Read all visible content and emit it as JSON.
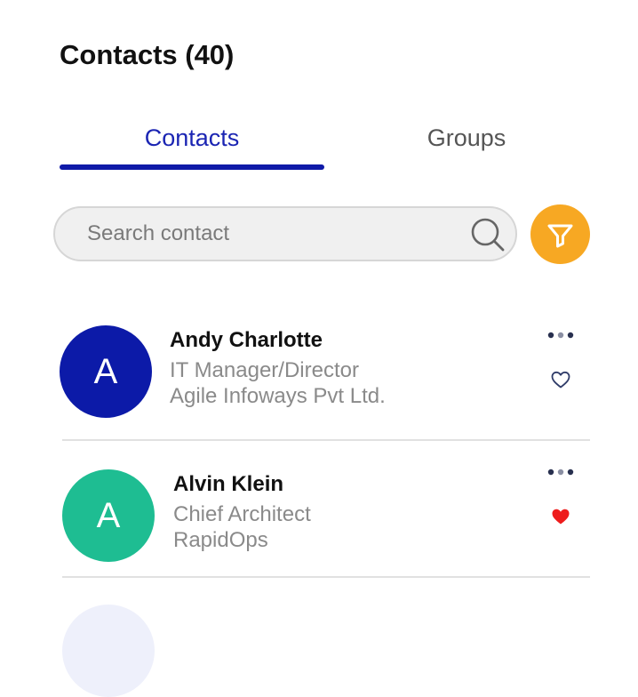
{
  "header": {
    "title": "Contacts (40)"
  },
  "tabs": [
    {
      "label": "Contacts",
      "active": true
    },
    {
      "label": "Groups",
      "active": false
    }
  ],
  "search": {
    "placeholder": "Search contact",
    "value": "",
    "icon": "search-icon"
  },
  "filter": {
    "icon": "filter-icon"
  },
  "colors": {
    "active_tab": "#1b25b3",
    "filter_button": "#f7a823",
    "favorite": "#ee1c1c"
  },
  "contacts": [
    {
      "initial": "A",
      "name": "Andy Charlotte",
      "role": "IT Manager/Director",
      "company": "Agile Infoways Pvt Ltd.",
      "avatar_color": "#0c1aa8",
      "favorite": false,
      "more_icon": "more-icon"
    },
    {
      "initial": "A",
      "name": "Alvin Klein",
      "role": "Chief Architect",
      "company": "RapidOps",
      "avatar_color": "#1ebd92",
      "favorite": true,
      "more_icon": "more-icon"
    }
  ]
}
